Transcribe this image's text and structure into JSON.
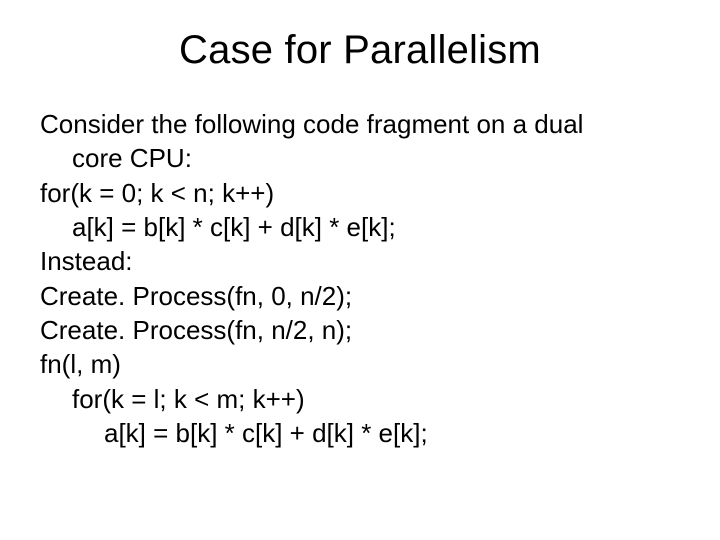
{
  "title": "Case for Parallelism",
  "lines": {
    "l0": "Consider the following code fragment on a dual",
    "l1": "core CPU:",
    "l2": "for(k = 0; k < n; k++)",
    "l3": "a[k] = b[k] * c[k] + d[k] * e[k];",
    "l4": "Instead:",
    "l5": "Create. Process(fn, 0, n/2);",
    "l6": "Create. Process(fn, n/2, n);",
    "l7": "fn(l, m)",
    "l8": "for(k = l; k < m; k++)",
    "l9": "a[k] = b[k] * c[k] + d[k] * e[k];"
  }
}
